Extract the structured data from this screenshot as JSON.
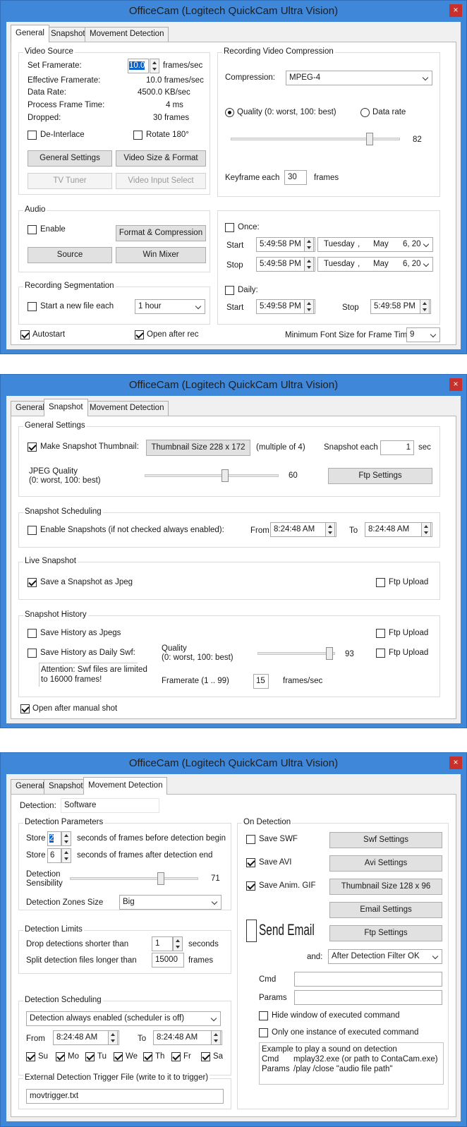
{
  "windows": [
    {
      "title": "OfficeCam (Logitech QuickCam Ultra Vision)",
      "close": "×",
      "tabs": [
        "General",
        "Snapshot",
        "Movement Detection"
      ],
      "active_tab": "General"
    },
    {
      "title": "OfficeCam (Logitech QuickCam Ultra Vision)",
      "close": "×",
      "tabs": [
        "General",
        "Snapshot",
        "Movement Detection"
      ],
      "active_tab": "Snapshot"
    },
    {
      "title": "OfficeCam (Logitech QuickCam Ultra Vision)",
      "close": "×",
      "tabs": [
        "General",
        "Snapshot",
        "Movement Detection"
      ],
      "active_tab": "Movement Detection"
    }
  ],
  "general": {
    "video_source": {
      "legend": "Video Source",
      "set_framerate_label": "Set Framerate:",
      "set_framerate_value": "10.0",
      "set_framerate_unit": "frames/sec",
      "effective_framerate_label": "Effective Framerate:",
      "effective_framerate_value": "10.0 frames/sec",
      "data_rate_label": "Data Rate:",
      "data_rate_value": "4500.0 KB/sec",
      "process_time_label": "Process Frame Time:",
      "process_time_value": "4 ms",
      "dropped_label": "Dropped:",
      "dropped_value": "30 frames",
      "deinterlace_label": "De-Interlace",
      "rotate_label": "Rotate 180°",
      "general_settings_btn": "General Settings",
      "video_size_btn": "Video Size & Format",
      "tv_tuner_btn": "TV Tuner",
      "video_input_btn": "Video Input Select"
    },
    "compression": {
      "legend": "Recording Video Compression",
      "compression_label": "Compression:",
      "compression_value": "MPEG-4",
      "quality_label": "Quality (0: worst, 100: best)",
      "datarate_label": "Data rate",
      "quality_value": "82",
      "quality_level": 82,
      "keyframe_label": "Keyframe each",
      "keyframe_value": "30",
      "keyframe_unit": "frames"
    },
    "audio": {
      "legend": "Audio",
      "enable_label": "Enable",
      "format_btn": "Format & Compression",
      "source_btn": "Source",
      "mixer_btn": "Win Mixer"
    },
    "schedule": {
      "once_label": "Once:",
      "start_label": "Start",
      "stop_label": "Stop",
      "once_start_time": "5:49:58 PM",
      "once_start_day": "Tuesday",
      "once_start_sep": ",",
      "once_start_month": "May",
      "once_start_date": "6, 20",
      "once_stop_time": "5:49:58 PM",
      "once_stop_day": "Tuesday",
      "once_stop_sep": ",",
      "once_stop_month": "May",
      "once_stop_date": "6, 20",
      "daily_label": "Daily:",
      "daily_start_label": "Start",
      "daily_start_time": "5:49:58 PM",
      "daily_stop_label": "Stop",
      "daily_stop_time": "5:49:58 PM"
    },
    "segmentation": {
      "legend": "Recording Segmentation",
      "new_file_label": "Start a new file each",
      "new_file_value": "1 hour"
    },
    "autostart_label": "Autostart",
    "open_after_rec_label": "Open after rec",
    "min_font_label": "Minimum Font Size for Frame Time",
    "min_font_value": "9"
  },
  "snapshot": {
    "general_settings": {
      "legend": "General Settings",
      "thumb_label": "Make Snapshot Thumbnail:",
      "thumb_size_btn": "Thumbnail Size 228 x 172",
      "multiple_label": "(multiple of 4)",
      "each_label": "Snapshot each",
      "each_value": "1",
      "each_unit": "sec",
      "jpeg_label_1": "JPEG Quality",
      "jpeg_label_2": "(0: worst, 100: best)",
      "jpeg_value": "60",
      "jpeg_level": 60,
      "ftp_btn": "Ftp Settings"
    },
    "scheduling": {
      "legend": "Snapshot Scheduling",
      "enable_label": "Enable Snapshots (if not checked always enabled):",
      "from_label": "From",
      "from_value": "8:24:48 AM",
      "to_label": "To",
      "to_value": "8:24:48 AM"
    },
    "live": {
      "legend": "Live Snapshot",
      "save_label": "Save a Snapshot as Jpeg",
      "ftp_label": "Ftp Upload"
    },
    "history": {
      "legend": "Snapshot History",
      "jpegs_label": "Save History as Jpegs",
      "ftp1_label": "Ftp Upload",
      "swf_label": "Save History as Daily Swf:",
      "quality_label_1": "Quality",
      "quality_label_2": "(0: worst, 100: best)",
      "quality_value": "93",
      "quality_level": 93,
      "ftp2_label": "Ftp Upload",
      "attention_1": "Attention: Swf files are limited",
      "attention_2": "to 16000 frames!",
      "framerate_label": "Framerate (1 .. 99)",
      "framerate_value": "15",
      "framerate_unit": "frames/sec"
    },
    "open_after_label": "Open after manual shot"
  },
  "movement": {
    "detection_label": "Detection:",
    "detection_value": "Software",
    "params": {
      "legend": "Detection Parameters",
      "store1_label": "Store",
      "store1_value": "2",
      "store1_desc": "seconds of frames before detection begin",
      "store2_label": "Store",
      "store2_value": "6",
      "store2_desc": "seconds of frames after detection end",
      "sens_label_1": "Detection",
      "sens_label_2": "Sensibility",
      "sens_value": "71",
      "sens_level": 71,
      "zones_label": "Detection Zones Size",
      "zones_value": "Big"
    },
    "limits": {
      "legend": "Detection Limits",
      "drop_label": "Drop detections shorter than",
      "drop_value": "1",
      "drop_unit": "seconds",
      "split_label": "Split detection files longer than",
      "split_value": "15000",
      "split_unit": "frames"
    },
    "scheduling": {
      "legend": "Detection Scheduling",
      "mode_value": "Detection always enabled (scheduler is off)",
      "from_label": "From",
      "from_value": "8:24:48 AM",
      "to_label": "To",
      "to_value": "8:24:48 AM",
      "days": [
        "Su",
        "Mo",
        "Tu",
        "We",
        "Th",
        "Fr",
        "Sa"
      ]
    },
    "trigger": {
      "legend": "External Detection Trigger File (write to it to trigger)",
      "value": "movtrigger.txt"
    },
    "on_detection": {
      "legend": "On Detection",
      "swf_label": "Save SWF",
      "swf_btn": "Swf Settings",
      "avi_label": "Save AVI",
      "avi_btn": "Avi Settings",
      "gif_label": "Save Anim. GIF",
      "gif_btn": "Thumbnail Size 128 x 96",
      "email_btn": "Email Settings",
      "send_email_label": "Send Email",
      "ftp_btn": "Ftp Settings",
      "and_label": "and:",
      "and_value": "After Detection Filter OK",
      "cmd_label": "Cmd",
      "params_label": "Params",
      "hide_label": "Hide window of executed command",
      "only_one_label": "Only one instance of executed command",
      "example_1": "Example to play a sound on detection",
      "example_cmd_label": "Cmd",
      "example_cmd_value": "mplay32.exe (or path to ContaCam.exe)",
      "example_params_label": "Params",
      "example_params_value": "/play /close \"audio file path\""
    }
  }
}
